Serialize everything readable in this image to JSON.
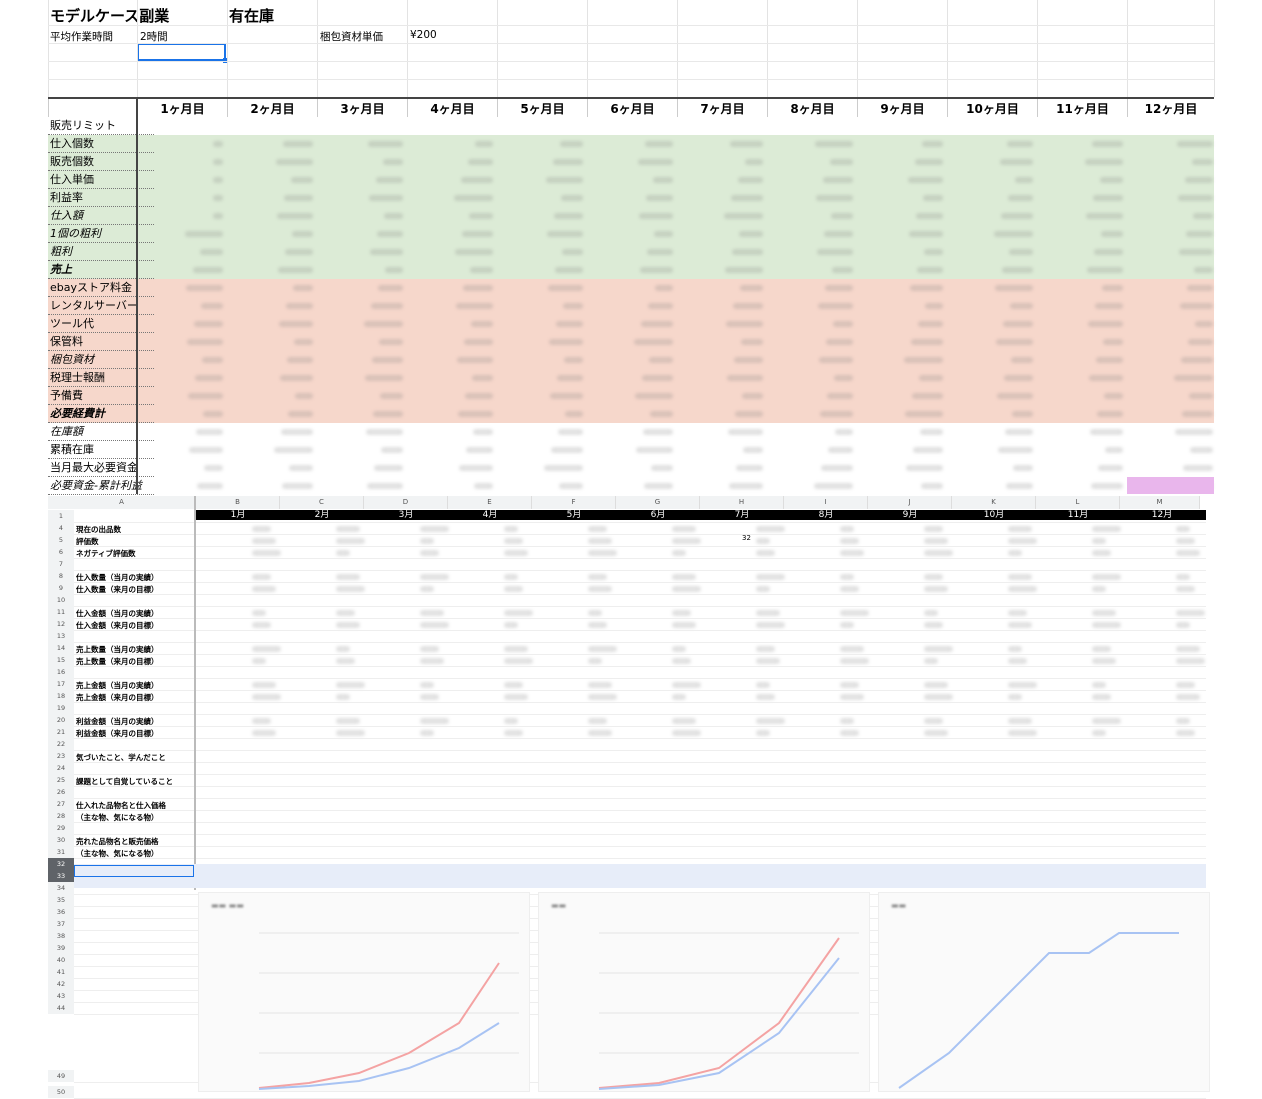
{
  "top": {
    "title": "モデルケース副業",
    "subtitle": "有在庫",
    "work_time_label": "平均作業時間",
    "work_time_value": "2時間",
    "packing_label": "梱包資材単価",
    "packing_value": "¥200",
    "months": [
      "1ヶ月目",
      "2ヶ月目",
      "3ヶ月目",
      "4ヶ月目",
      "5ヶ月目",
      "6ヶ月目",
      "7ヶ月目",
      "8ヶ月目",
      "9ヶ月目",
      "10ヶ月目",
      "11ヶ月目",
      "12ヶ月目"
    ],
    "rows": [
      {
        "label": "販売リミット",
        "style": "normal",
        "band": "white"
      },
      {
        "label": "仕入個数",
        "style": "normal",
        "band": "green"
      },
      {
        "label": "販売個数",
        "style": "normal",
        "band": "green"
      },
      {
        "label": "仕入単価",
        "style": "normal",
        "band": "green"
      },
      {
        "label": "利益率",
        "style": "normal",
        "band": "green"
      },
      {
        "label": "仕入額",
        "style": "italic",
        "band": "green"
      },
      {
        "label": "1個の粗利",
        "style": "italic",
        "band": "green"
      },
      {
        "label": "粗利",
        "style": "italic",
        "band": "green"
      },
      {
        "label": "売上",
        "style": "bolditalic",
        "band": "green"
      },
      {
        "label": "ebayストア料金",
        "style": "normal",
        "band": "red"
      },
      {
        "label": "レンタルサーバー",
        "style": "normal",
        "band": "red"
      },
      {
        "label": "ツール代",
        "style": "normal",
        "band": "red"
      },
      {
        "label": "保管料",
        "style": "normal",
        "band": "red"
      },
      {
        "label": "梱包資材",
        "style": "italic",
        "band": "red"
      },
      {
        "label": "税理士報酬",
        "style": "normal",
        "band": "red"
      },
      {
        "label": "予備費",
        "style": "normal",
        "band": "red"
      },
      {
        "label": "必要経費計",
        "style": "bolditalic",
        "band": "red"
      },
      {
        "label": "在庫額",
        "style": "italic",
        "band": "white"
      },
      {
        "label": "累積在庫",
        "style": "normal",
        "band": "white"
      },
      {
        "label": "当月最大必要資金",
        "style": "normal",
        "band": "white"
      },
      {
        "label": "必要資金-累計利益",
        "style": "italic",
        "band": "white"
      }
    ],
    "colors": {
      "green": "#dcebd6",
      "red": "#f6d7cb",
      "accent": "#1a73e8",
      "pink": "#e9b6ec"
    }
  },
  "bottom": {
    "col_letters": [
      "A",
      "B",
      "C",
      "D",
      "E",
      "F",
      "G",
      "H",
      "I",
      "J",
      "K",
      "L",
      "M"
    ],
    "months": [
      "1月",
      "2月",
      "3月",
      "4月",
      "5月",
      "6月",
      "7月",
      "8月",
      "9月",
      "10月",
      "11月",
      "12月"
    ],
    "rows": [
      {
        "n": "1",
        "label": ""
      },
      {
        "n": "4",
        "label": "現在の出品数"
      },
      {
        "n": "5",
        "label": "評価数"
      },
      {
        "n": "6",
        "label": "ネガティブ評価数"
      },
      {
        "n": "7",
        "label": ""
      },
      {
        "n": "8",
        "label": "仕入数量（当月の実績）"
      },
      {
        "n": "9",
        "label": "仕入数量（来月の目標）"
      },
      {
        "n": "10",
        "label": ""
      },
      {
        "n": "11",
        "label": "仕入金額（当月の実績）"
      },
      {
        "n": "12",
        "label": "仕入金額（来月の目標）"
      },
      {
        "n": "13",
        "label": ""
      },
      {
        "n": "14",
        "label": "売上数量（当月の実績）"
      },
      {
        "n": "15",
        "label": "売上数量（来月の目標）"
      },
      {
        "n": "16",
        "label": ""
      },
      {
        "n": "17",
        "label": "売上金額（当月の実績）"
      },
      {
        "n": "18",
        "label": "売上金額（来月の目標）"
      },
      {
        "n": "19",
        "label": ""
      },
      {
        "n": "20",
        "label": "利益金額（当月の実績）"
      },
      {
        "n": "21",
        "label": "利益金額（来月の目標）"
      },
      {
        "n": "22",
        "label": ""
      },
      {
        "n": "23",
        "label": "気づいたこと、学んだこと"
      },
      {
        "n": "24",
        "label": ""
      },
      {
        "n": "25",
        "label": "課題として自覚していること"
      },
      {
        "n": "26",
        "label": ""
      },
      {
        "n": "27",
        "label": "仕入れた品物名と仕入価格"
      },
      {
        "n": "28",
        "label": "（主な物、気になる物）"
      },
      {
        "n": "29",
        "label": ""
      },
      {
        "n": "30",
        "label": "売れた品物名と販売価格"
      },
      {
        "n": "31",
        "label": "（主な物、気になる物）"
      },
      {
        "n": "32",
        "label": ""
      },
      {
        "n": "33",
        "label": ""
      },
      {
        "n": "34",
        "label": ""
      },
      {
        "n": "35",
        "label": ""
      },
      {
        "n": "36",
        "label": ""
      },
      {
        "n": "37",
        "label": ""
      },
      {
        "n": "38",
        "label": ""
      },
      {
        "n": "39",
        "label": ""
      },
      {
        "n": "40",
        "label": ""
      },
      {
        "n": "41",
        "label": ""
      },
      {
        "n": "42",
        "label": ""
      },
      {
        "n": "43",
        "label": ""
      },
      {
        "n": "44",
        "label": ""
      },
      {
        "n": "49",
        "label": ""
      },
      {
        "n": "50",
        "label": ""
      }
    ],
    "row7_values": {
      "h": "32"
    }
  }
}
